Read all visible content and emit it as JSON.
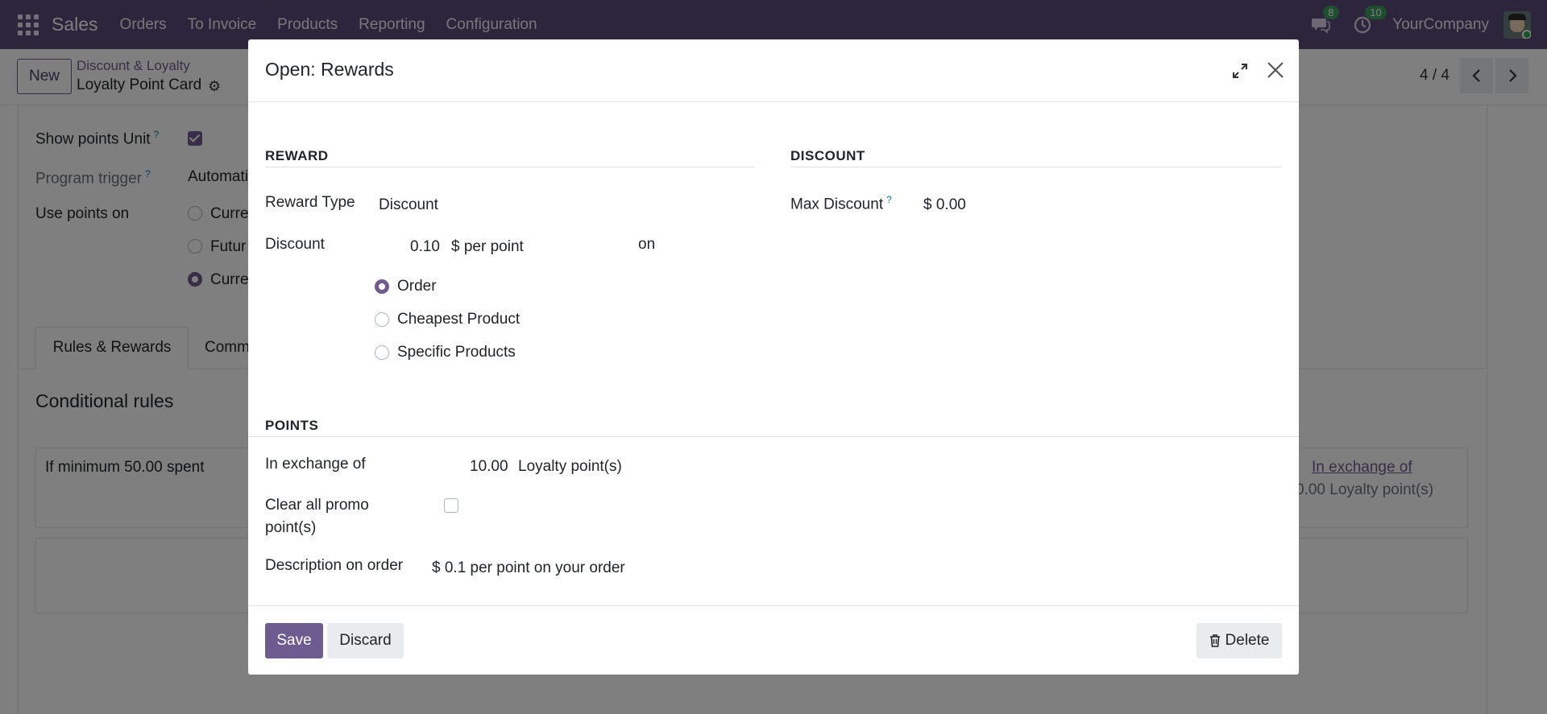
{
  "navbar": {
    "app_name": "Sales",
    "menu": [
      "Orders",
      "To Invoice",
      "Products",
      "Reporting",
      "Configuration"
    ],
    "messages_count": "8",
    "activities_count": "10",
    "company": "YourCompany"
  },
  "control": {
    "new_label": "New",
    "breadcrumb_parent": "Discount & Loyalty",
    "breadcrumb_current": "Loyalty Point Card",
    "pager": "4 / 4"
  },
  "background": {
    "show_points_unit_label": "Show points Unit",
    "program_trigger_label": "Program trigger",
    "program_trigger_value": "Automati",
    "use_points_on_label": "Use points on",
    "use_points_options": [
      "Curre",
      "Futur",
      "Curre"
    ],
    "tab_rules": "Rules & Rewards",
    "tab_comm": "Comm",
    "conditional_rules": "Conditional rules",
    "rule_text": "If minimum 50.00 spent",
    "right_link": "In exchange of",
    "right_value": "0.00 Loyalty point(s)"
  },
  "modal": {
    "title": "Open: Rewards",
    "reward_section": "REWARD",
    "discount_section": "DISCOUNT",
    "reward_type_label": "Reward Type",
    "reward_type_value": "Discount",
    "discount_label": "Discount",
    "discount_value": "0.10",
    "discount_unit": "$ per point",
    "on_label": "on",
    "apply_options": [
      "Order",
      "Cheapest Product",
      "Specific Products"
    ],
    "selected_option": "Order",
    "max_discount_label": "Max Discount",
    "max_discount_value": "$ 0.00",
    "points_section": "POINTS",
    "exchange_label": "In exchange of",
    "exchange_value": "10.00",
    "exchange_unit": "Loyalty point(s)",
    "clear_promo_label_1": "Clear all promo",
    "clear_promo_label_2": "point(s)",
    "description_label": "Description on order",
    "description_value": "$ 0.1 per point on your order",
    "save_label": "Save",
    "discard_label": "Discard",
    "delete_label": "Delete"
  },
  "colors": {
    "navbar": "#5b4b78",
    "primary": "#6e5b8f",
    "badge": "#3a9d5d"
  }
}
